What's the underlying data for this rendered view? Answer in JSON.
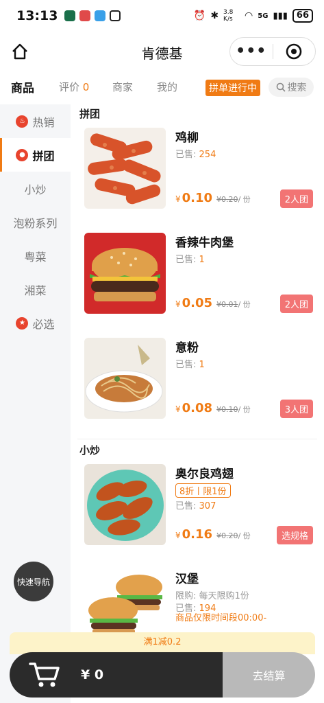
{
  "status_bar": {
    "time": "13:13",
    "network_speed": "3.8 K/s",
    "signal": "5G",
    "battery": "66"
  },
  "navbar": {
    "title": "肯德基",
    "more": "•••"
  },
  "tabs": {
    "goods": "商品",
    "reviews": "评价",
    "reviews_count": "0",
    "merchant": "商家",
    "mine": "我的",
    "group_status": "拼单进行中",
    "search": "搜索"
  },
  "sidebar": {
    "items": [
      {
        "label": "热销",
        "icon": "fire-icon"
      },
      {
        "label": "拼团",
        "icon": "group-icon"
      },
      {
        "label": "小炒",
        "icon": ""
      },
      {
        "label": "泡粉系列",
        "icon": ""
      },
      {
        "label": "粤菜",
        "icon": ""
      },
      {
        "label": "湘菜",
        "icon": ""
      },
      {
        "label": "必选",
        "icon": "star-icon"
      }
    ],
    "quick_nav": "快速导航"
  },
  "sections": [
    {
      "title": "拼团",
      "products": [
        {
          "name": "鸡柳",
          "sold_label": "已售:",
          "sold": "254",
          "yen": "¥",
          "price": "0.10",
          "orig": "¥0.20",
          "unit": "/ 份",
          "button": "2人团"
        },
        {
          "name": "香辣牛肉堡",
          "sold_label": "已售:",
          "sold": "1",
          "yen": "¥",
          "price": "0.05",
          "orig": "¥0.01",
          "unit": "/ 份",
          "button": "2人团"
        },
        {
          "name": "意粉",
          "sold_label": "已售:",
          "sold": "1",
          "yen": "¥",
          "price": "0.08",
          "orig": "¥0.10",
          "unit": "/ 份",
          "button": "3人团"
        }
      ]
    },
    {
      "title": "小炒",
      "products": [
        {
          "name": "奥尔良鸡翅",
          "tag": "8折丨限1份",
          "sold_label": "已售:",
          "sold": "307",
          "yen": "¥",
          "price": "0.16",
          "orig": "¥0.20",
          "unit": "/ 份",
          "button": "选规格"
        },
        {
          "name": "汉堡",
          "limit": "限购: 每天限购1份",
          "sold_label": "已售:",
          "sold": "194",
          "note": "商品仅限时间段00:00-"
        }
      ]
    }
  ],
  "bottom": {
    "promo": "满1减0.2",
    "total": "¥ 0",
    "checkout": "去结算"
  },
  "colors": {
    "accent": "#f07b14",
    "group_button": "#f27474",
    "sidebar_bg": "#f5f6f8",
    "cart_bg": "#2b2b2b",
    "checkout_bg": "#b9b9b9",
    "promo_bg": "#fdf3c9"
  }
}
